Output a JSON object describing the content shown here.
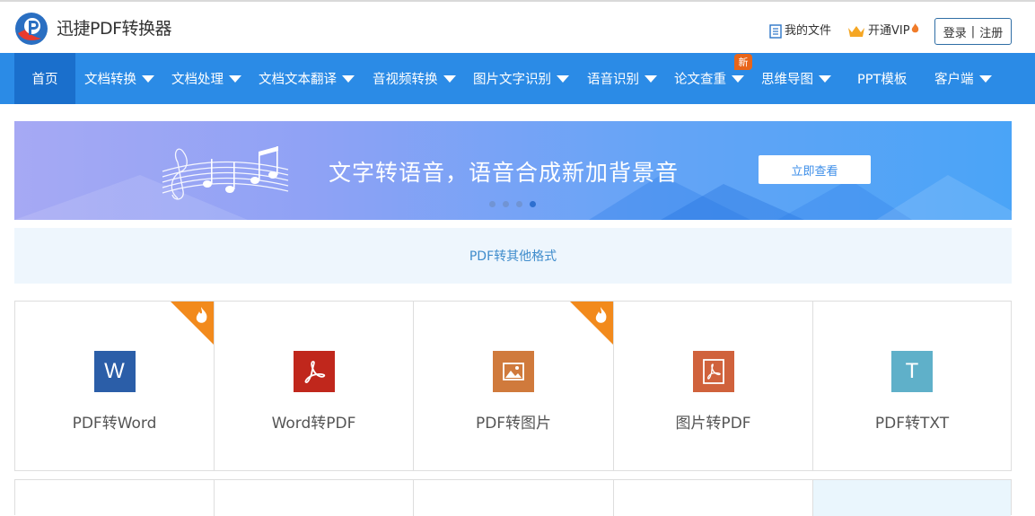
{
  "header": {
    "app_title": "迅捷PDF转换器",
    "my_files": "我的文件",
    "vip": "开通VIP",
    "login": "登录",
    "separator": "|",
    "register": "注册"
  },
  "nav": {
    "items": [
      {
        "label": "首页",
        "active": true,
        "dropdown": false
      },
      {
        "label": "文档转换",
        "dropdown": true
      },
      {
        "label": "文档处理",
        "dropdown": true
      },
      {
        "label": "文档文本翻译",
        "dropdown": true
      },
      {
        "label": "音视频转换",
        "dropdown": true
      },
      {
        "label": "图片文字识别",
        "dropdown": true
      },
      {
        "label": "语音识别",
        "dropdown": true
      },
      {
        "label": "论文查重",
        "dropdown": true
      },
      {
        "label": "思维导图",
        "dropdown": true
      },
      {
        "label": "PPT模板",
        "dropdown": false
      },
      {
        "label": "客户端",
        "dropdown": true
      }
    ],
    "new_badge": "新"
  },
  "banner": {
    "title": "文字转语音，语音合成新加背景音",
    "button": "立即查看",
    "slide_count": 4,
    "active_slide": 4
  },
  "category": {
    "title": "PDF转其他格式"
  },
  "tools": [
    {
      "label": "PDF转Word",
      "icon": "word-icon",
      "glyph": "W",
      "color": "#2b5ea8",
      "hot": true
    },
    {
      "label": "Word转PDF",
      "icon": "pdf-icon",
      "color": "#c0271c",
      "hot": false
    },
    {
      "label": "PDF转图片",
      "icon": "image-icon",
      "color": "#d07a3c",
      "hot": true
    },
    {
      "label": "图片转PDF",
      "icon": "pdf-icon",
      "color": "#d0623c",
      "hot": false
    },
    {
      "label": "PDF转TXT",
      "icon": "txt-icon",
      "glyph": "T",
      "color": "#5fb0c9",
      "hot": false
    }
  ],
  "colors": {
    "nav_bg": "#2b8be6",
    "nav_active": "#1a6fcc",
    "hot_badge": "#f28a1c"
  }
}
